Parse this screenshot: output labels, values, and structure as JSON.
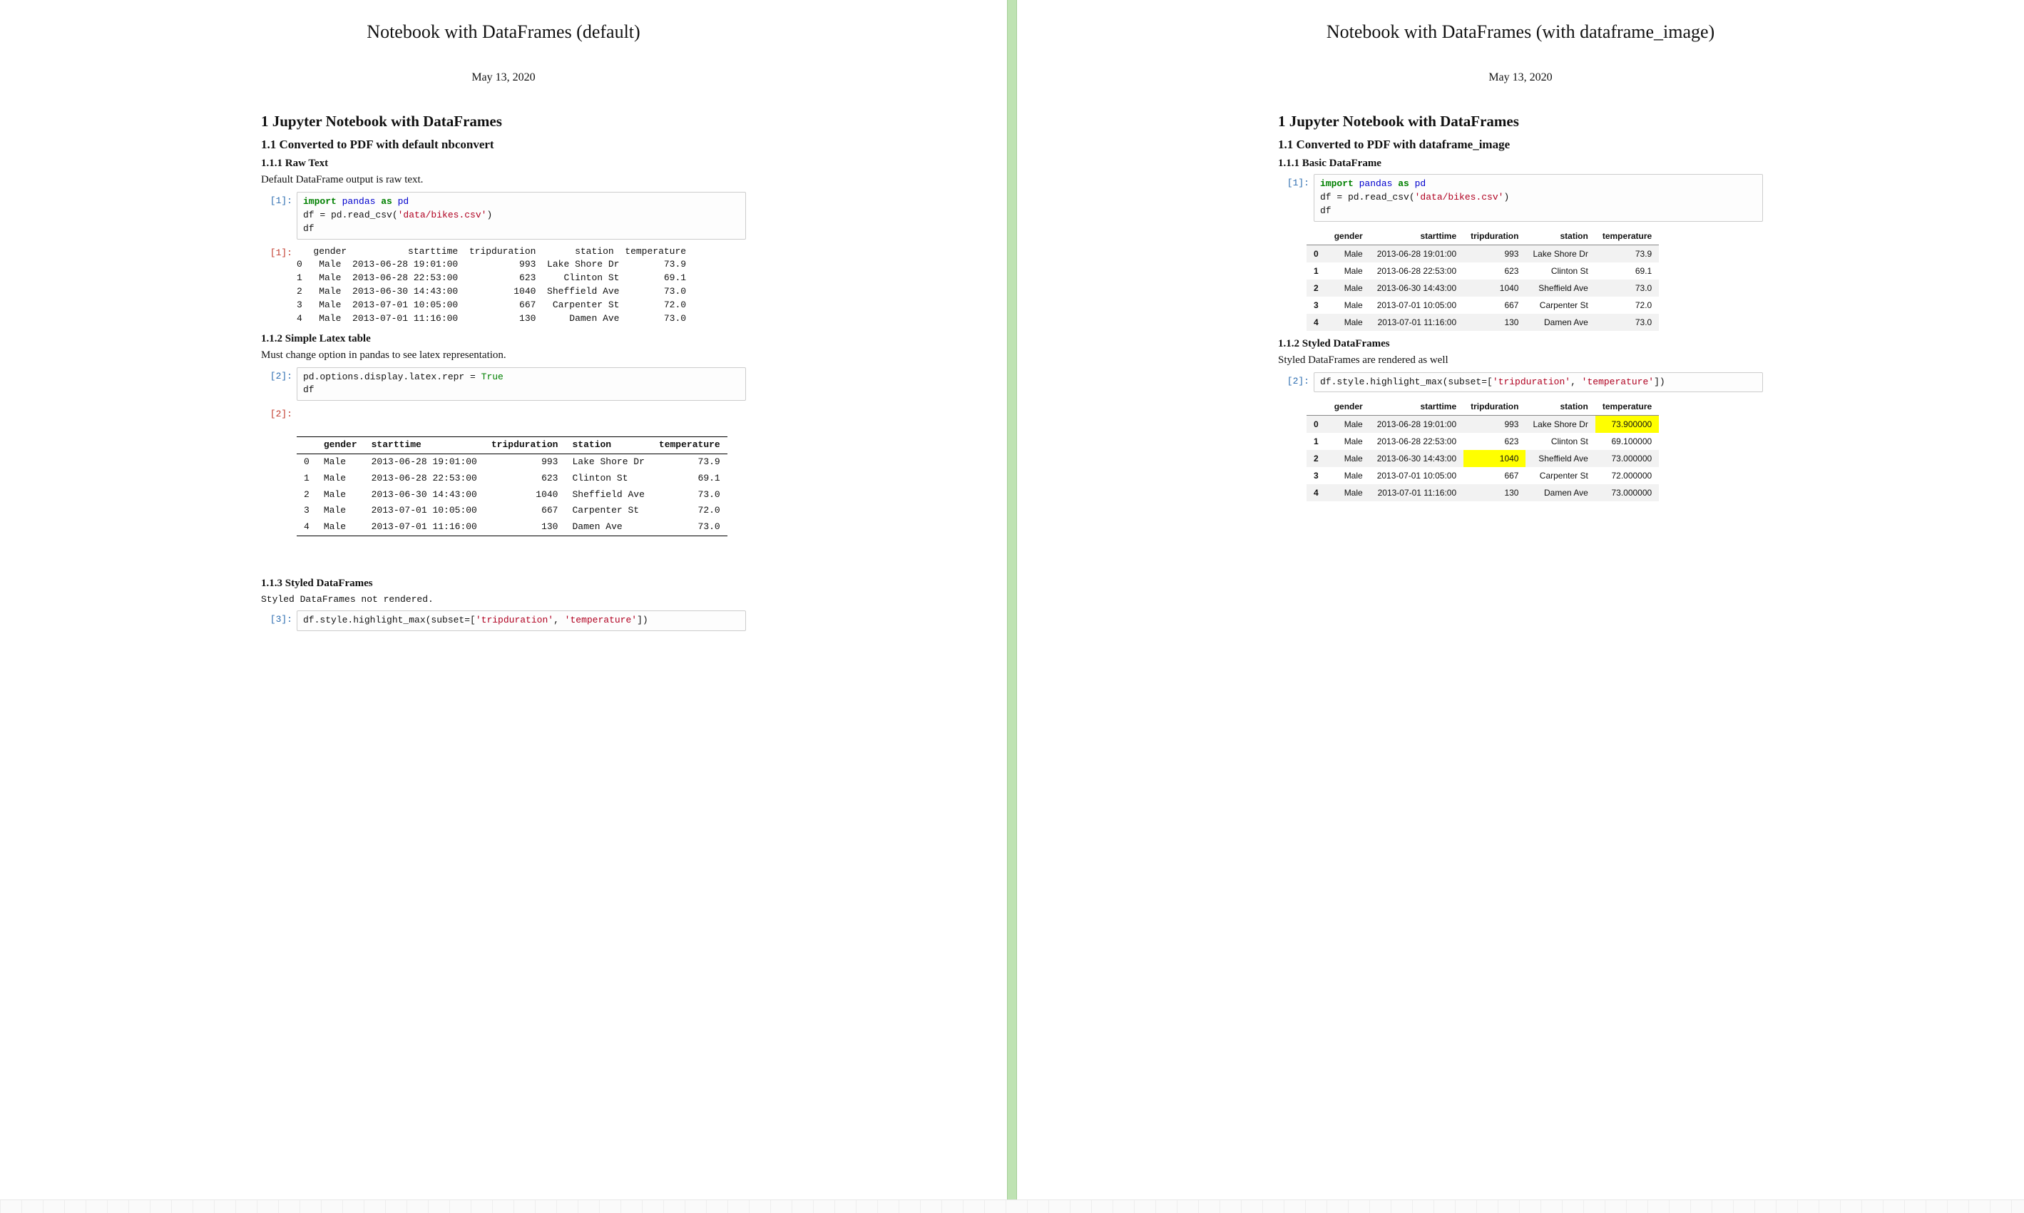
{
  "left": {
    "title": "Notebook with DataFrames (default)",
    "date": "May 13, 2020",
    "h1": "1   Jupyter Notebook with DataFrames",
    "h2": "1.1   Converted to PDF with default nbconvert",
    "sec1_h3": "1.1.1   Raw Text",
    "sec1_para": "Default DataFrame output is raw text.",
    "cell1_prompt": "[1]:",
    "cell1_code_tokens": [
      {
        "t": "import ",
        "c": "kw"
      },
      {
        "t": "pandas ",
        "c": "kw2"
      },
      {
        "t": "as ",
        "c": "kw"
      },
      {
        "t": "pd",
        "c": "kw2"
      },
      {
        "t": "\n"
      },
      {
        "t": "df = pd.read_csv("
      },
      {
        "t": "'data/bikes.csv'",
        "c": "str"
      },
      {
        "t": ")\n"
      },
      {
        "t": "df"
      }
    ],
    "cell1_out_prompt": "[1]:",
    "cell1_out_text": "   gender           starttime  tripduration       station  temperature\n0   Male  2013-06-28 19:01:00           993  Lake Shore Dr        73.9\n1   Male  2013-06-28 22:53:00           623     Clinton St        69.1\n2   Male  2013-06-30 14:43:00          1040  Sheffield Ave        73.0\n3   Male  2013-07-01 10:05:00           667   Carpenter St        72.0\n4   Male  2013-07-01 11:16:00           130      Damen Ave        73.0",
    "sec2_h3": "1.1.2   Simple Latex table",
    "sec2_para": "Must change option in pandas to see latex representation.",
    "cell2_prompt": "[2]:",
    "cell2_code_tokens": [
      {
        "t": "pd.options.display.latex.repr = "
      },
      {
        "t": "True",
        "c": "boolv"
      },
      {
        "t": "\n"
      },
      {
        "t": "df"
      }
    ],
    "cell2_out_prompt": "[2]:",
    "latex_table": {
      "columns": [
        "",
        "gender",
        "starttime",
        "tripduration",
        "station",
        "temperature"
      ],
      "rows": [
        [
          "0",
          "Male",
          "2013-06-28 19:01:00",
          "993",
          "Lake Shore Dr",
          "73.9"
        ],
        [
          "1",
          "Male",
          "2013-06-28 22:53:00",
          "623",
          "Clinton St",
          "69.1"
        ],
        [
          "2",
          "Male",
          "2013-06-30 14:43:00",
          "1040",
          "Sheffield Ave",
          "73.0"
        ],
        [
          "3",
          "Male",
          "2013-07-01 10:05:00",
          "667",
          "Carpenter St",
          "72.0"
        ],
        [
          "4",
          "Male",
          "2013-07-01 11:16:00",
          "130",
          "Damen Ave",
          "73.0"
        ]
      ]
    },
    "sec3_h3": "1.1.3   Styled DataFrames",
    "sec3_para": "Styled DataFrames not rendered.",
    "cell3_prompt": "[3]:",
    "cell3_code_tokens": [
      {
        "t": "df.style.highlight_max(subset=["
      },
      {
        "t": "'tripduration'",
        "c": "str"
      },
      {
        "t": ", "
      },
      {
        "t": "'temperature'",
        "c": "str"
      },
      {
        "t": "])"
      }
    ]
  },
  "right": {
    "title": "Notebook with DataFrames (with dataframe_image)",
    "date": "May 13, 2020",
    "h1": "1   Jupyter Notebook with DataFrames",
    "h2": "1.1   Converted to PDF with dataframe_image",
    "sec1_h3": "1.1.1   Basic DataFrame",
    "cell1_prompt": "[1]:",
    "cell1_code_tokens": [
      {
        "t": "import ",
        "c": "kw"
      },
      {
        "t": "pandas ",
        "c": "kw2"
      },
      {
        "t": "as ",
        "c": "kw"
      },
      {
        "t": "pd",
        "c": "kw2"
      },
      {
        "t": "\n"
      },
      {
        "t": "df = pd.read_csv("
      },
      {
        "t": "'data/bikes.csv'",
        "c": "str"
      },
      {
        "t": ")\n"
      },
      {
        "t": "df"
      }
    ],
    "df1": {
      "columns": [
        "",
        "gender",
        "starttime",
        "tripduration",
        "station",
        "temperature"
      ],
      "rows": [
        {
          "idx": "0",
          "cells": [
            "Male",
            "2013-06-28 19:01:00",
            "993",
            "Lake Shore Dr",
            "73.9"
          ]
        },
        {
          "idx": "1",
          "cells": [
            "Male",
            "2013-06-28 22:53:00",
            "623",
            "Clinton St",
            "69.1"
          ]
        },
        {
          "idx": "2",
          "cells": [
            "Male",
            "2013-06-30 14:43:00",
            "1040",
            "Sheffield Ave",
            "73.0"
          ]
        },
        {
          "idx": "3",
          "cells": [
            "Male",
            "2013-07-01 10:05:00",
            "667",
            "Carpenter St",
            "72.0"
          ]
        },
        {
          "idx": "4",
          "cells": [
            "Male",
            "2013-07-01 11:16:00",
            "130",
            "Damen Ave",
            "73.0"
          ]
        }
      ]
    },
    "sec2_h3": "1.1.2   Styled DataFrames",
    "sec2_para": "Styled DataFrames are rendered as well",
    "cell2_prompt": "[2]:",
    "cell2_code_tokens": [
      {
        "t": "df.style.highlight_max(subset=["
      },
      {
        "t": "'tripduration'",
        "c": "str"
      },
      {
        "t": ", "
      },
      {
        "t": "'temperature'",
        "c": "str"
      },
      {
        "t": "])"
      }
    ],
    "df2": {
      "columns": [
        "",
        "gender",
        "starttime",
        "tripduration",
        "station",
        "temperature"
      ],
      "highlight_cols": [
        "tripduration",
        "temperature"
      ],
      "rows": [
        {
          "idx": "0",
          "cells": [
            "Male",
            "2013-06-28 19:01:00",
            "993",
            "Lake Shore Dr",
            "73.900000"
          ],
          "hl": [
            false,
            false,
            false,
            false,
            true
          ]
        },
        {
          "idx": "1",
          "cells": [
            "Male",
            "2013-06-28 22:53:00",
            "623",
            "Clinton St",
            "69.100000"
          ],
          "hl": [
            false,
            false,
            false,
            false,
            false
          ]
        },
        {
          "idx": "2",
          "cells": [
            "Male",
            "2013-06-30 14:43:00",
            "1040",
            "Sheffield Ave",
            "73.000000"
          ],
          "hl": [
            false,
            false,
            true,
            false,
            false
          ]
        },
        {
          "idx": "3",
          "cells": [
            "Male",
            "2013-07-01 10:05:00",
            "667",
            "Carpenter St",
            "72.000000"
          ],
          "hl": [
            false,
            false,
            false,
            false,
            false
          ]
        },
        {
          "idx": "4",
          "cells": [
            "Male",
            "2013-07-01 11:16:00",
            "130",
            "Damen Ave",
            "73.000000"
          ],
          "hl": [
            false,
            false,
            false,
            false,
            false
          ]
        }
      ]
    }
  }
}
